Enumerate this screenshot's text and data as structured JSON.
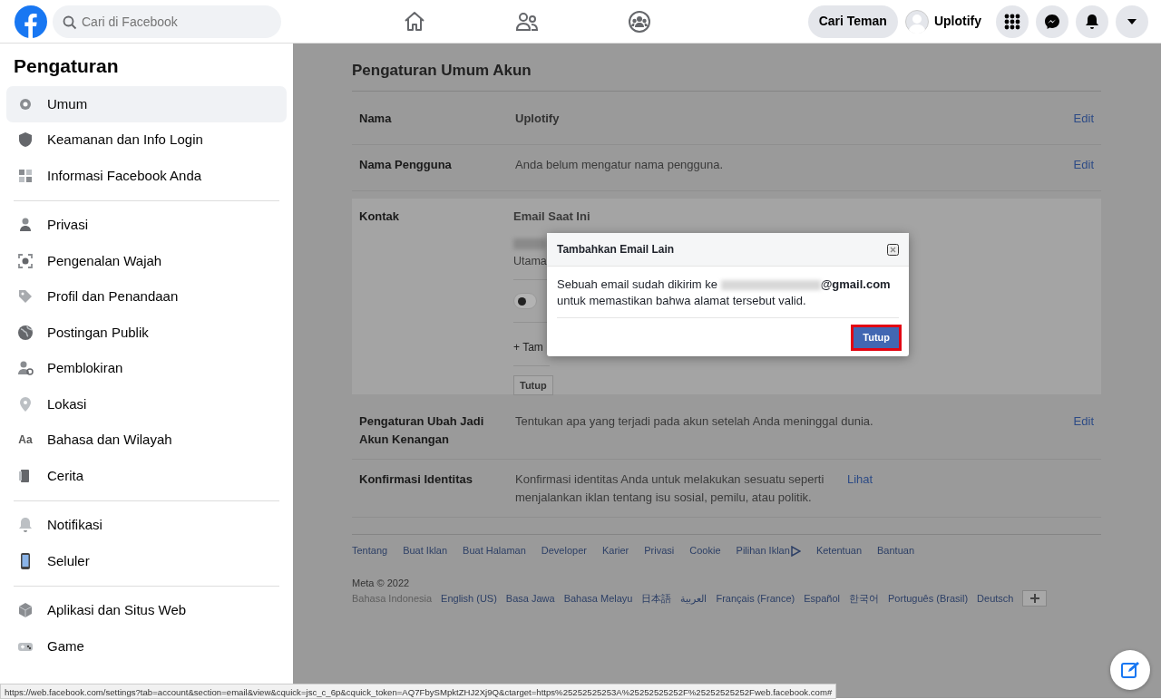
{
  "topbar": {
    "search": {
      "placeholder": "Cari di Facebook"
    },
    "find_friends": "Cari Teman",
    "profile_name": "Uplotify"
  },
  "sidebar": {
    "title": "Pengaturan",
    "groups": [
      [
        {
          "label": "Umum",
          "selected": true
        },
        {
          "label": "Keamanan dan Info Login",
          "selected": false
        },
        {
          "label": "Informasi Facebook Anda",
          "selected": false
        }
      ],
      [
        {
          "label": "Privasi",
          "selected": false
        },
        {
          "label": "Pengenalan Wajah",
          "selected": false
        },
        {
          "label": "Profil dan Penandaan",
          "selected": false
        },
        {
          "label": "Postingan Publik",
          "selected": false
        },
        {
          "label": "Pemblokiran",
          "selected": false
        },
        {
          "label": "Lokasi",
          "selected": false
        },
        {
          "label": "Bahasa dan Wilayah",
          "selected": false,
          "glyph": "Aa"
        },
        {
          "label": "Cerita",
          "selected": false
        }
      ],
      [
        {
          "label": "Notifikasi",
          "selected": false
        },
        {
          "label": "Seluler",
          "selected": false
        }
      ],
      [
        {
          "label": "Aplikasi dan Situs Web",
          "selected": false
        },
        {
          "label": "Game",
          "selected": false
        }
      ]
    ]
  },
  "main": {
    "title": "Pengaturan Umum Akun",
    "rows": [
      {
        "kind": "plain",
        "label": "Nama",
        "value": "Uplotify",
        "action": "Edit"
      },
      {
        "kind": "plain",
        "label": "Nama Pengguna",
        "value": "Anda belum mengatur nama pengguna.",
        "action": "Edit"
      },
      {
        "kind": "expanded",
        "label": "Kontak",
        "heading": "Email Saat Ini",
        "email_note": "Utama",
        "toggle_on": false,
        "add_link": "+ Tam",
        "close_button": "Tutup"
      },
      {
        "kind": "plain",
        "label": "Pengaturan Ubah Jadi Akun Kenangan",
        "value": "Tentukan apa yang terjadi pada akun setelah Anda meninggal dunia.",
        "action": "Edit"
      },
      {
        "kind": "plain",
        "label": "Konfirmasi Identitas",
        "value": "Konfirmasi identitas Anda untuk melakukan sesuatu seperti menjalankan iklan tentang isu sosial, pemilu, atau politik.",
        "action": "Lihat"
      }
    ]
  },
  "footer": {
    "links": [
      {
        "label": "Tentang"
      },
      {
        "label": "Buat Iklan"
      },
      {
        "label": "Buat Halaman"
      },
      {
        "label": "Developer"
      },
      {
        "label": "Karier"
      },
      {
        "label": "Privasi"
      },
      {
        "label": "Cookie"
      },
      {
        "label": "Pilihan Iklan",
        "ad_icon": true
      },
      {
        "label": "Ketentuan"
      },
      {
        "label": "Bantuan"
      }
    ],
    "copyright": "Meta © 2022",
    "languages": [
      {
        "label": "Bahasa Indonesia",
        "selected": true
      },
      {
        "label": "English (US)",
        "selected": false
      },
      {
        "label": "Basa Jawa",
        "selected": false
      },
      {
        "label": "Bahasa Melayu",
        "selected": false
      },
      {
        "label": "日本語",
        "selected": false
      },
      {
        "label": "العربية",
        "selected": false
      },
      {
        "label": "Français (France)",
        "selected": false
      },
      {
        "label": "Español",
        "selected": false
      },
      {
        "label": "한국어",
        "selected": false
      },
      {
        "label": "Português (Brasil)",
        "selected": false
      },
      {
        "label": "Deutsch",
        "selected": false
      }
    ]
  },
  "modal": {
    "title": "Tambahkan Email Lain",
    "message_before": "Sebuah email sudah dikirim ke",
    "message_after": "**@gmail.com** untuk memastikan bahwa alamat tersebut valid.",
    "button": "Tutup",
    "button_highlighted": true
  },
  "status_bar": {
    "url": "https://web.facebook.com/settings?tab=account&section=email&view&cquick=jsc_c_6p&cquick_token=AQ7FbySMpktZHJ2Xj9Q&ctarget=https%25252525253A%25252525252F%25252525252Fweb.facebook.com#"
  }
}
